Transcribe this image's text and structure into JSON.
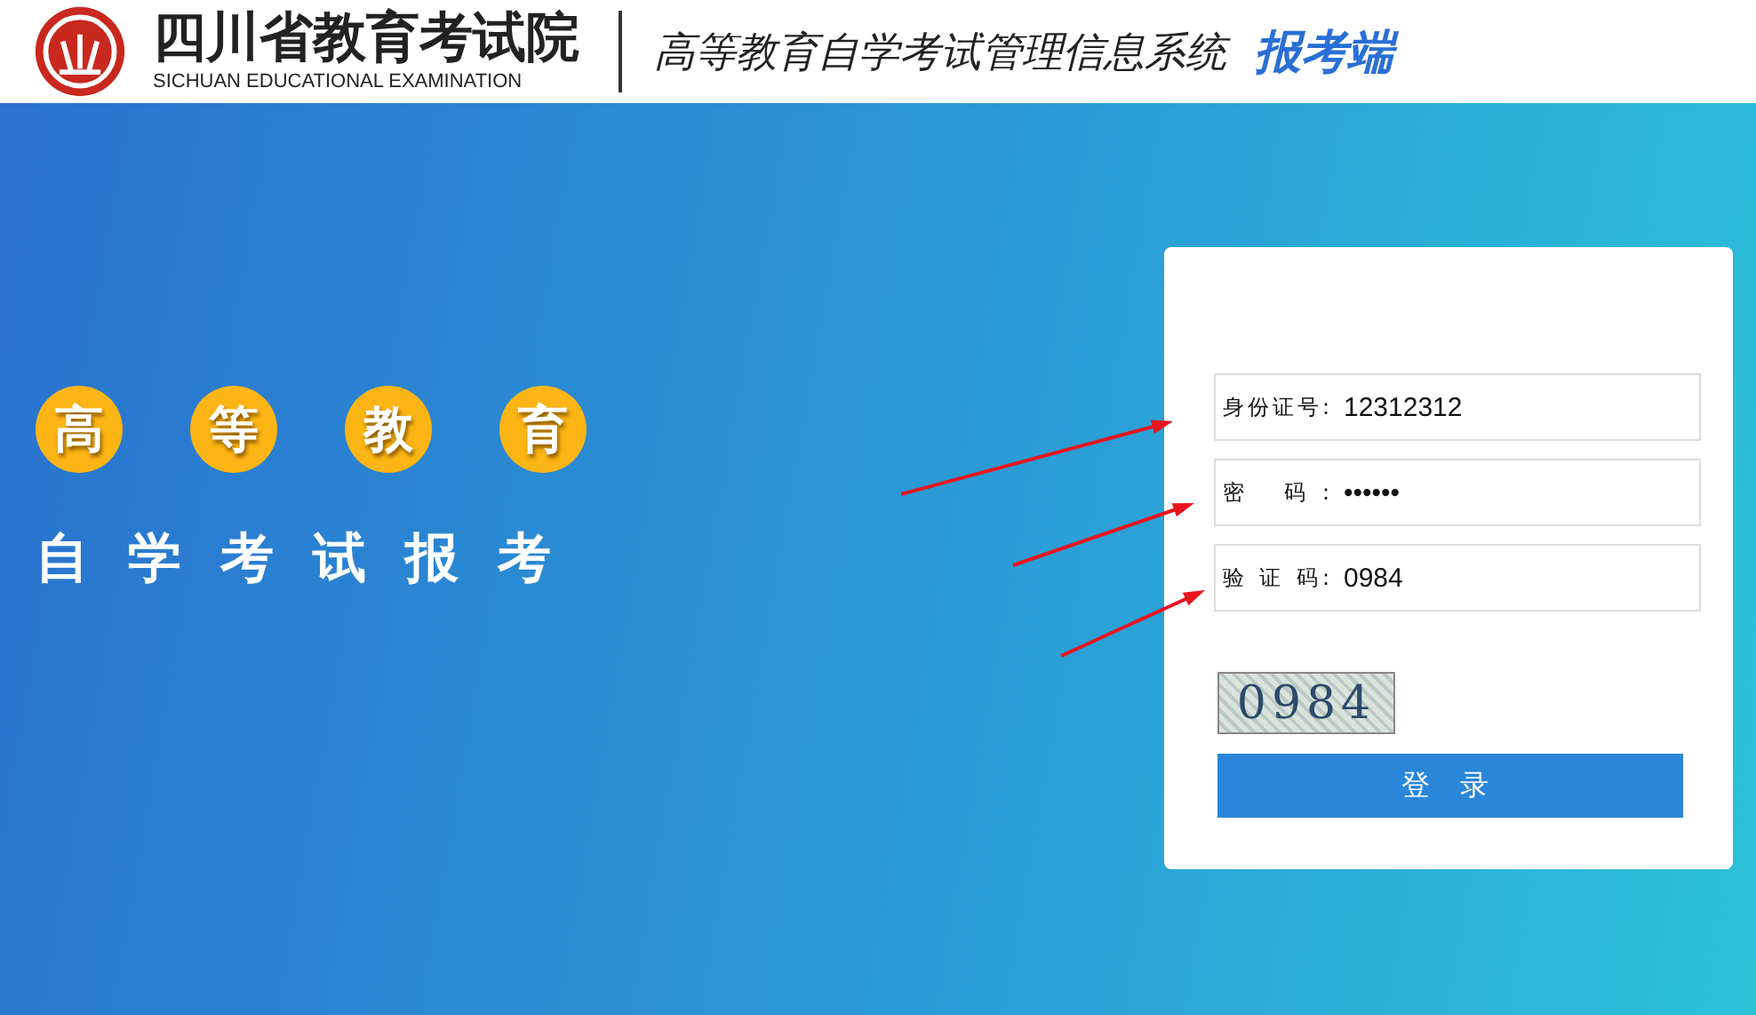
{
  "header": {
    "org_name": "四川省教育考试院",
    "org_name_en": "SICHUAN EDUCATIONAL EXAMINATION",
    "system_title": "高等教育自学考试管理信息系统",
    "system_suffix": "报考端"
  },
  "banner": {
    "circle_chars": [
      "高",
      "等",
      "教",
      "育"
    ],
    "slogan": "自学考试报考"
  },
  "login": {
    "fields": [
      {
        "label": "身份证号:",
        "value": "12312312"
      },
      {
        "label": "密 码:",
        "value": "••••••"
      },
      {
        "label": "验 证 码:",
        "value": "0984"
      }
    ],
    "captcha": "0984",
    "button": "登 录"
  }
}
